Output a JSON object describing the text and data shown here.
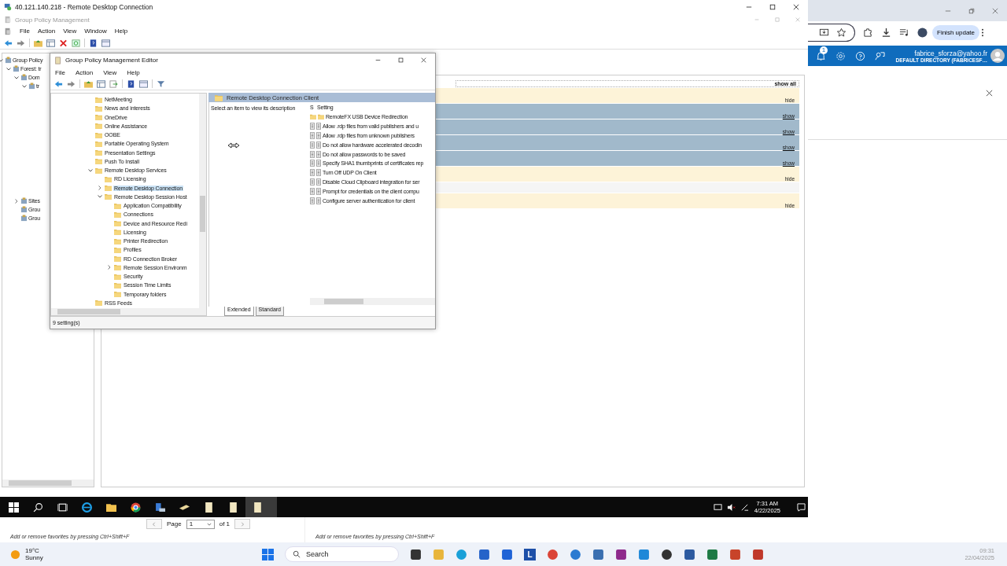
{
  "rdp_window": {
    "title": "40.121.140.218 - Remote Desktop Connection"
  },
  "gpm": {
    "title": "Group Policy Management",
    "menu": [
      "File",
      "Action",
      "View",
      "Window",
      "Help"
    ],
    "tree": [
      {
        "label": "Group Policy",
        "expanded": true,
        "children": [
          {
            "label": "Forest: tr",
            "expanded": true,
            "children": [
              {
                "label": "Dom",
                "expanded": true,
                "children": [
                  {
                    "label": "tr",
                    "expanded": true
                  }
                ]
              },
              {
                "label": "Sites",
                "expanded": false
              },
              {
                "label": "Grou"
              },
              {
                "label": "Grou"
              }
            ]
          }
        ]
      }
    ],
    "report": {
      "show_all": "show all",
      "rows": [
        {
          "kind": "section",
          "expanded": true,
          "link": "hide"
        },
        {
          "kind": "section",
          "expanded": false,
          "link": "show"
        },
        {
          "kind": "section",
          "expanded": false,
          "link": "show"
        },
        {
          "kind": "section",
          "expanded": false,
          "link": "show"
        },
        {
          "kind": "section",
          "expanded": false,
          "link": "show"
        },
        {
          "kind": "section",
          "expanded": true,
          "link": "hide"
        },
        {
          "kind": "blank"
        },
        {
          "kind": "section",
          "expanded": true,
          "link": "hide"
        }
      ]
    }
  },
  "editor": {
    "title": "Group Policy Management Editor",
    "menu": [
      "File",
      "Action",
      "View",
      "Help"
    ],
    "tree": [
      {
        "label": "NetMeeting",
        "selected": false
      },
      {
        "label": "News and interests",
        "selected": false
      },
      {
        "label": "OneDrive",
        "selected": false
      },
      {
        "label": "Online Assistance",
        "selected": false
      },
      {
        "label": "OOBE",
        "selected": false
      },
      {
        "label": "Portable Operating System",
        "selected": false
      },
      {
        "label": "Presentation Settings",
        "selected": false
      },
      {
        "label": "Push To Install",
        "selected": false
      },
      {
        "label": "Remote Desktop Services",
        "selected": false,
        "expanded": true,
        "children": [
          {
            "label": "RD Licensing",
            "selected": false
          },
          {
            "label": "Remote Desktop Connection",
            "selected": true,
            "expanded": false
          },
          {
            "label": "Remote Desktop Session Host",
            "selected": false,
            "expanded": true,
            "children": [
              {
                "label": "Application Compatibility",
                "selected": false
              },
              {
                "label": "Connections",
                "selected": false
              },
              {
                "label": "Device and Resource Redi",
                "selected": false
              },
              {
                "label": "Licensing",
                "selected": false
              },
              {
                "label": "Printer Redirection",
                "selected": false
              },
              {
                "label": "Profiles",
                "selected": false
              },
              {
                "label": "RD Connection Broker",
                "selected": false
              },
              {
                "label": "Remote Session Environm",
                "selected": false,
                "expanded": false
              },
              {
                "label": "Security",
                "selected": false
              },
              {
                "label": "Session Time Limits",
                "selected": false
              },
              {
                "label": "Temporary folders",
                "selected": false
              }
            ]
          }
        ]
      },
      {
        "label": "RSS Feeds",
        "selected": false
      }
    ],
    "pane_title": "Remote Desktop Connection Client",
    "description": "Select an item to view its description",
    "columns": [
      "S",
      "Setting"
    ],
    "settings": [
      {
        "kind": "folder",
        "label": "RemoteFX USB Device Redirection"
      },
      {
        "kind": "policy",
        "label": "Allow .rdp files from valid publishers and u"
      },
      {
        "kind": "policy",
        "label": "Allow .rdp files from unknown publishers"
      },
      {
        "kind": "policy",
        "label": "Do not allow hardware accelerated decodin"
      },
      {
        "kind": "policy",
        "label": "Do not allow passwords to be saved"
      },
      {
        "kind": "policy",
        "label": "Specify SHA1 thumbprints of certificates rep"
      },
      {
        "kind": "policy",
        "label": "Turn Off UDP On Client"
      },
      {
        "kind": "policy",
        "label": "Disable Cloud Clipboard integration for ser"
      },
      {
        "kind": "policy",
        "label": "Prompt for credentials on the client compu"
      },
      {
        "kind": "policy",
        "label": "Configure server authentication for client"
      }
    ],
    "tabs": [
      {
        "label": "Extended",
        "selected": true
      },
      {
        "label": "Standard",
        "selected": false
      }
    ],
    "status": "9 setting(s)"
  },
  "remote_taskbar": {
    "time": "7:31 AM",
    "date": "4/22/2025"
  },
  "browser": {
    "pager": {
      "label": "Page",
      "value": "1",
      "total": "of 1"
    },
    "favorites_hints": [
      "Add or remove favorites by pressing Ctrl+Shift+F",
      "Add or remove favorites by pressing Ctrl+Shift+F"
    ],
    "update_button": "Finish update",
    "notification_count": "1",
    "account_email": "fabrice_sforza@yahoo.fr",
    "account_directory": "DEFAULT DIRECTORY (FABRICESF…"
  },
  "taskbar": {
    "temperature": "19°C",
    "weather": "Sunny",
    "search_placeholder": "Search",
    "app_letter": "L",
    "time": "09:31",
    "date": "22/04/2025"
  }
}
